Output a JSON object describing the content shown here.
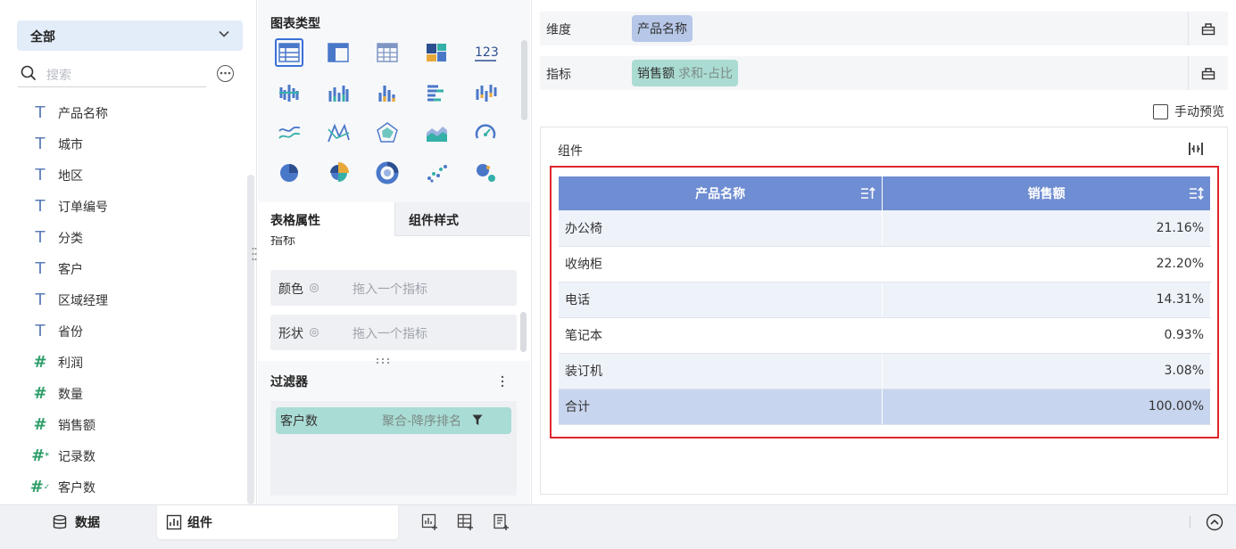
{
  "left_panel": {
    "dropdown": {
      "label": "全部"
    },
    "search": {
      "placeholder": "搜索"
    },
    "fields": [
      {
        "label": "产品名称",
        "type": "text"
      },
      {
        "label": "城市",
        "type": "text"
      },
      {
        "label": "地区",
        "type": "text"
      },
      {
        "label": "订单编号",
        "type": "text"
      },
      {
        "label": "分类",
        "type": "text"
      },
      {
        "label": "客户",
        "type": "text"
      },
      {
        "label": "区域经理",
        "type": "text"
      },
      {
        "label": "省份",
        "type": "text"
      },
      {
        "label": "利润",
        "type": "number"
      },
      {
        "label": "数量",
        "type": "number"
      },
      {
        "label": "销售额",
        "type": "number"
      },
      {
        "label": "记录数",
        "type": "number-star"
      },
      {
        "label": "客户数",
        "type": "number-calc"
      }
    ]
  },
  "middle_panel": {
    "chart_type_title": "图表类型",
    "chart_icons": [
      "table-detail-icon",
      "table-group-icon",
      "table-cross-icon",
      "treemap-icon",
      "number-card-icon",
      "bar-cluster-icon",
      "bar-chart-icon",
      "bar-chart-alt-icon",
      "horizontal-bar-icon",
      "range-bar-icon",
      "line-chart-icon",
      "polyline-chart-icon",
      "radar-chart-icon",
      "area-chart-icon",
      "gauge-chart-icon",
      "pie-chart-icon",
      "rose-chart-icon",
      "donut-chart-icon",
      "scatter-chart-icon",
      "bubble-chart-icon"
    ],
    "number_card_text": "123",
    "tab_table_attr": "表格属性",
    "tab_component_style": "组件样式",
    "cut_off_label": "指标",
    "color_attr": {
      "label": "颜色",
      "placeholder": "拖入一个指标"
    },
    "shape_attr": {
      "label": "形状",
      "placeholder": "拖入一个指标"
    },
    "filter_title": "过滤器",
    "filter_chip": {
      "field": "客户数",
      "desc": "聚合-降序排名"
    }
  },
  "right_panel": {
    "dimension": {
      "label": "维度",
      "chip": "产品名称"
    },
    "metric": {
      "label": "指标",
      "chip": "销售额",
      "chip_sub": "求和-占比"
    },
    "manual_preview": "手动预览",
    "component_title": "组件",
    "table": {
      "headers": [
        "产品名称",
        "销售额"
      ],
      "rows": [
        [
          "办公椅",
          "21.16%"
        ],
        [
          "收纳柜",
          "22.20%"
        ],
        [
          "电话",
          "14.31%"
        ],
        [
          "笔记本",
          "0.93%"
        ],
        [
          "装订机",
          "3.08%"
        ]
      ],
      "total": [
        "合计",
        "100.00%"
      ]
    }
  },
  "bottom_bar": {
    "tab_data": "数据",
    "tab_component": "组件"
  },
  "colors": {
    "header_blue": "#6f8dd2",
    "highlight_red": "#e0262b",
    "dim_chip": "#b6c7e8",
    "metric_chip": "#abdcd3"
  }
}
